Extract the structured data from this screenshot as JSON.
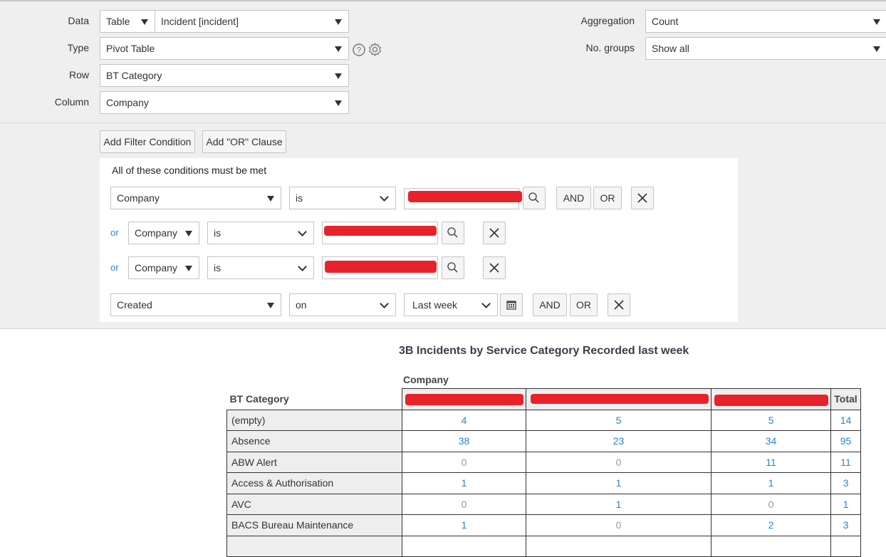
{
  "config": {
    "data_label": "Data",
    "data_source": "Table",
    "data_table": "Incident [incident]",
    "type_label": "Type",
    "type_value": "Pivot Table",
    "row_label": "Row",
    "row_value": "BT Category",
    "column_label": "Column",
    "column_value": "Company",
    "aggregation_label": "Aggregation",
    "aggregation_value": "Count",
    "groups_label": "No. groups",
    "groups_value": "Show all"
  },
  "filter": {
    "add_condition": "Add Filter Condition",
    "add_or": "Add \"OR\" Clause",
    "heading": "All of these conditions must be met",
    "or_label": "or",
    "and_btn": "AND",
    "or_btn": "OR",
    "conditions": [
      {
        "field": "Company",
        "operator": "is"
      },
      {
        "field": "Company",
        "operator": "is"
      },
      {
        "field": "Company",
        "operator": "is"
      },
      {
        "field": "Created",
        "operator": "on",
        "value": "Last week"
      }
    ]
  },
  "report": {
    "title": "3B Incidents by Service Category Recorded last week",
    "column_group": "Company",
    "row_header": "BT Category",
    "total_header": "Total",
    "rows": [
      {
        "label": "(empty)",
        "c1": "4",
        "c2": "5",
        "c3": "5",
        "total": "14"
      },
      {
        "label": "Absence",
        "c1": "38",
        "c2": "23",
        "c3": "34",
        "total": "95"
      },
      {
        "label": "ABW Alert",
        "c1": "0",
        "c2": "0",
        "c3": "11",
        "total": "11"
      },
      {
        "label": "Access & Authorisation",
        "c1": "1",
        "c2": "1",
        "c3": "1",
        "total": "3"
      },
      {
        "label": "AVC",
        "c1": "0",
        "c2": "1",
        "c3": "0",
        "total": "1"
      },
      {
        "label": "BACS Bureau Maintenance",
        "c1": "1",
        "c2": "0",
        "c3": "2",
        "total": "3"
      }
    ]
  },
  "colors": {
    "link": "#2b86d1",
    "redaction": "#e8222a"
  }
}
